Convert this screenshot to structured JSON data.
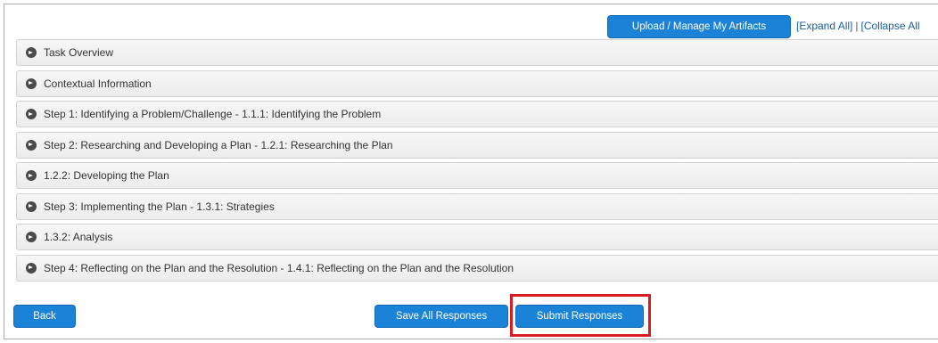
{
  "toolbar": {
    "upload_label": "Upload / Manage My Artifacts",
    "expand_all": "[Expand All]",
    "separator": "|",
    "collapse_all": "[Collapse All"
  },
  "sections": [
    {
      "label": "Task Overview"
    },
    {
      "label": "Contextual Information"
    },
    {
      "label": "Step 1: Identifying a Problem/Challenge - 1.1.1: Identifying the Problem"
    },
    {
      "label": "Step 2: Researching and Developing a Plan - 1.2.1: Researching the Plan"
    },
    {
      "label": "1.2.2: Developing the Plan"
    },
    {
      "label": "Step 3: Implementing the Plan - 1.3.1: Strategies"
    },
    {
      "label": "1.3.2: Analysis"
    },
    {
      "label": "Step 4: Reflecting on the Plan and the Resolution - 1.4.1: Reflecting on the Plan and the Resolution"
    }
  ],
  "footer": {
    "back_label": "Back",
    "save_label": "Save All Responses",
    "submit_label": "Submit Responses"
  },
  "colors": {
    "button_blue": "#1a83d8",
    "link_blue": "#1a5fa8",
    "highlight_red": "#d91c24"
  },
  "icons": {
    "section_icon": "arrow-right-circle-icon"
  }
}
